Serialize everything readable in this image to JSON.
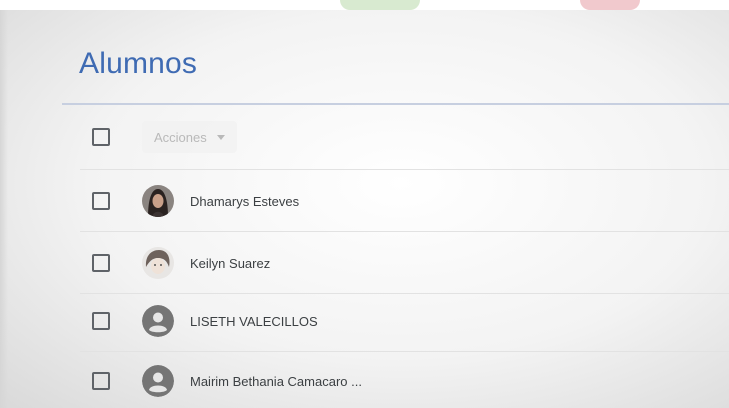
{
  "page": {
    "title": "Alumnos"
  },
  "toolbar": {
    "actions_label": "Acciones",
    "actions_icon": "caret-down-icon"
  },
  "students": [
    {
      "name": "Dhamarys Esteves",
      "avatar": "photo"
    },
    {
      "name": "Keilyn Suarez",
      "avatar": "photo"
    },
    {
      "name": "LISETH VALECILLOS",
      "avatar": "default-person-icon"
    },
    {
      "name": "Mairim Bethania Camacaro ...",
      "avatar": "default-person-icon"
    }
  ],
  "colors": {
    "title": "#3f6bb3",
    "text": "#3c4043",
    "checkbox": "#5f6368",
    "avatar_default": "#757575"
  }
}
